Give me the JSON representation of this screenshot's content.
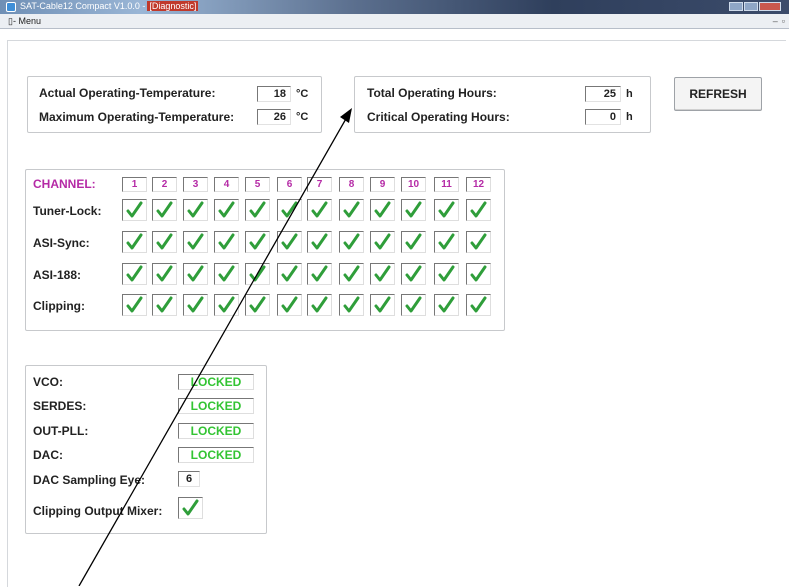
{
  "window": {
    "title": "SAT-Cable12 Compact V1.0.0 - [Diagnostic]",
    "title_main": "SAT-Cable12 Compact V1.0.0 -",
    "title_chip": "[Diagnostic]"
  },
  "menu": {
    "label": "Menu"
  },
  "temperature": {
    "actual_label": "Actual Operating-Temperature:",
    "actual_value": "18",
    "actual_unit": "°C",
    "max_label": "Maximum Operating-Temperature:",
    "max_value": "26",
    "max_unit": "°C"
  },
  "hours": {
    "total_label": "Total Operating Hours:",
    "total_value": "25",
    "total_unit": "h",
    "critical_label": "Critical Operating Hours:",
    "critical_value": "0",
    "critical_unit": "h"
  },
  "refresh_label": "REFRESH",
  "channels": {
    "header_label": "CHANNEL:",
    "numbers": [
      "1",
      "2",
      "3",
      "4",
      "5",
      "6",
      "7",
      "8",
      "9",
      "10",
      "11",
      "12"
    ],
    "rows": [
      {
        "label": "Tuner-Lock:",
        "checked": [
          true,
          true,
          true,
          true,
          true,
          true,
          true,
          true,
          true,
          true,
          true,
          true
        ]
      },
      {
        "label": "ASI-Sync:",
        "checked": [
          true,
          true,
          true,
          true,
          true,
          true,
          true,
          true,
          true,
          true,
          true,
          true
        ]
      },
      {
        "label": "ASI-188:",
        "checked": [
          true,
          true,
          true,
          true,
          true,
          true,
          true,
          true,
          true,
          true,
          true,
          true
        ]
      },
      {
        "label": "Clipping:",
        "checked": [
          true,
          true,
          true,
          true,
          true,
          true,
          true,
          true,
          true,
          true,
          true,
          true
        ]
      }
    ]
  },
  "status": {
    "vco_label": "VCO:",
    "vco_value": "LOCKED",
    "serdes_label": "SERDES:",
    "serdes_value": "LOCKED",
    "outpll_label": "OUT-PLL:",
    "outpll_value": "LOCKED",
    "dac_label": "DAC:",
    "dac_value": "LOCKED",
    "eye_label": "DAC Sampling Eye:",
    "eye_value": "6",
    "mixer_label": "Clipping Output Mixer:",
    "mixer_checked": true
  },
  "colors": {
    "channel_accent": "#b52aa6",
    "locked_green": "#33c433",
    "check_green": "#2f9e3a"
  },
  "icons": {
    "check": "check-icon",
    "app": "app-icon"
  }
}
